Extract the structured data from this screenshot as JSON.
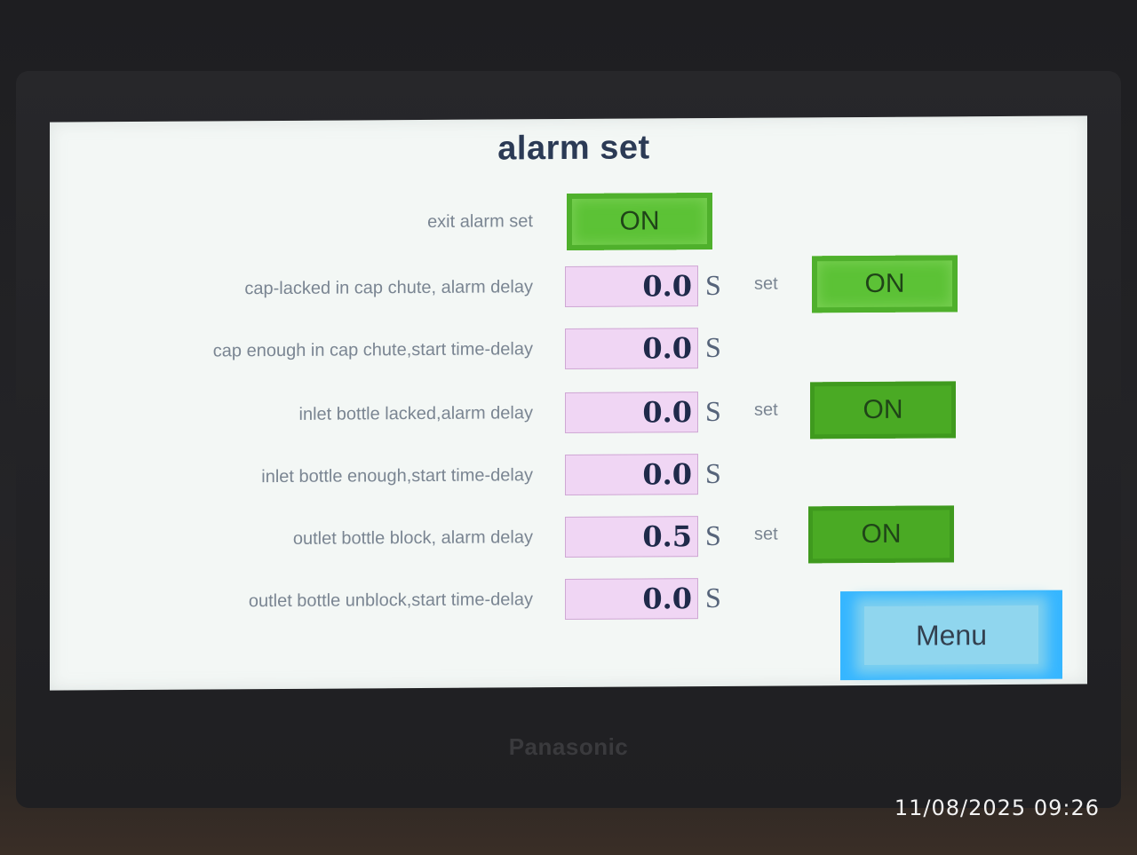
{
  "screen": {
    "title": "alarm set",
    "exit_alarm": {
      "label": "exit alarm set",
      "button": "ON"
    },
    "rows": [
      {
        "label": "cap-lacked in cap chute, alarm delay",
        "value": "0.0",
        "unit": "S",
        "set_label": "set",
        "button": "ON"
      },
      {
        "label": "cap enough in cap chute,start time-delay",
        "value": "0.0",
        "unit": "S"
      },
      {
        "label": "inlet bottle lacked,alarm delay",
        "value": "0.0",
        "unit": "S",
        "set_label": "set",
        "button": "ON"
      },
      {
        "label": "inlet bottle enough,start time-delay",
        "value": "0.0",
        "unit": "S"
      },
      {
        "label": "outlet bottle block, alarm delay",
        "value": "0.5",
        "unit": "S",
        "set_label": "set",
        "button": "ON"
      },
      {
        "label": "outlet bottle unblock,start time-delay",
        "value": "0.0",
        "unit": "S"
      }
    ],
    "menu_button": "Menu"
  },
  "device_brand": "Panasonic",
  "photo_timestamp": "11/08/2025 09:26",
  "colors": {
    "on_button": "#5cc236",
    "value_box": "#f0d6f4",
    "menu_button": "#36b6ff",
    "title_text": "#2b3a55"
  }
}
